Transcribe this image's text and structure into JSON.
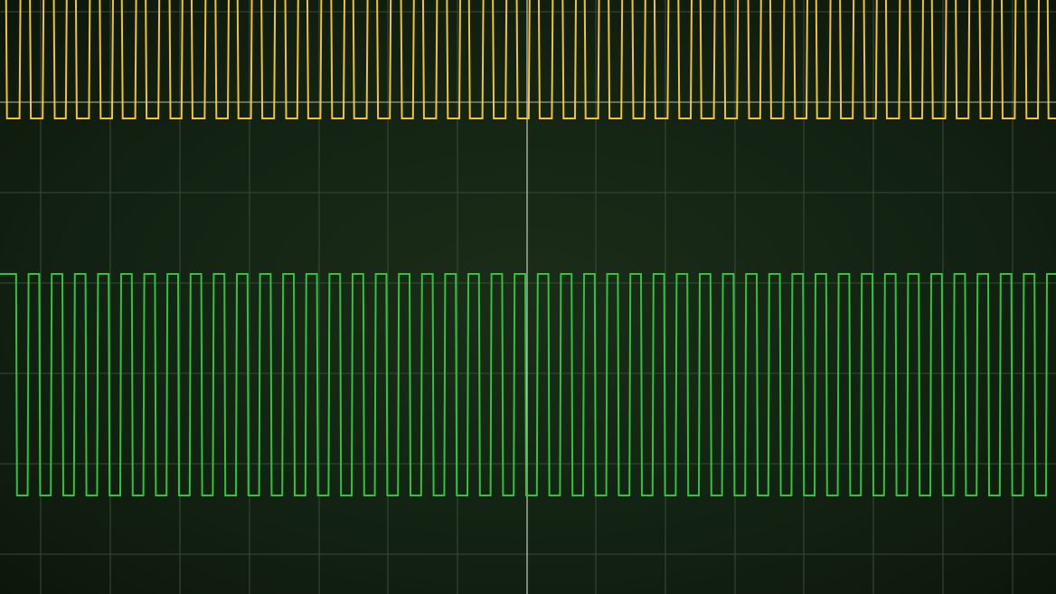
{
  "scope": {
    "grid": true,
    "trigger_cursor": true,
    "colors": {
      "background": "#132313",
      "grid": "#3a4a38",
      "cursor": "#e8ece6",
      "channel_1": "#f2c230",
      "channel_2": "#2fc43c"
    },
    "channels": [
      {
        "id": "ch1",
        "shape": "square",
        "cycles_visible": 45,
        "icon": "waveform-yellow"
      },
      {
        "id": "ch2",
        "shape": "square",
        "cycles_visible": 45,
        "icon": "waveform-green"
      }
    ]
  }
}
